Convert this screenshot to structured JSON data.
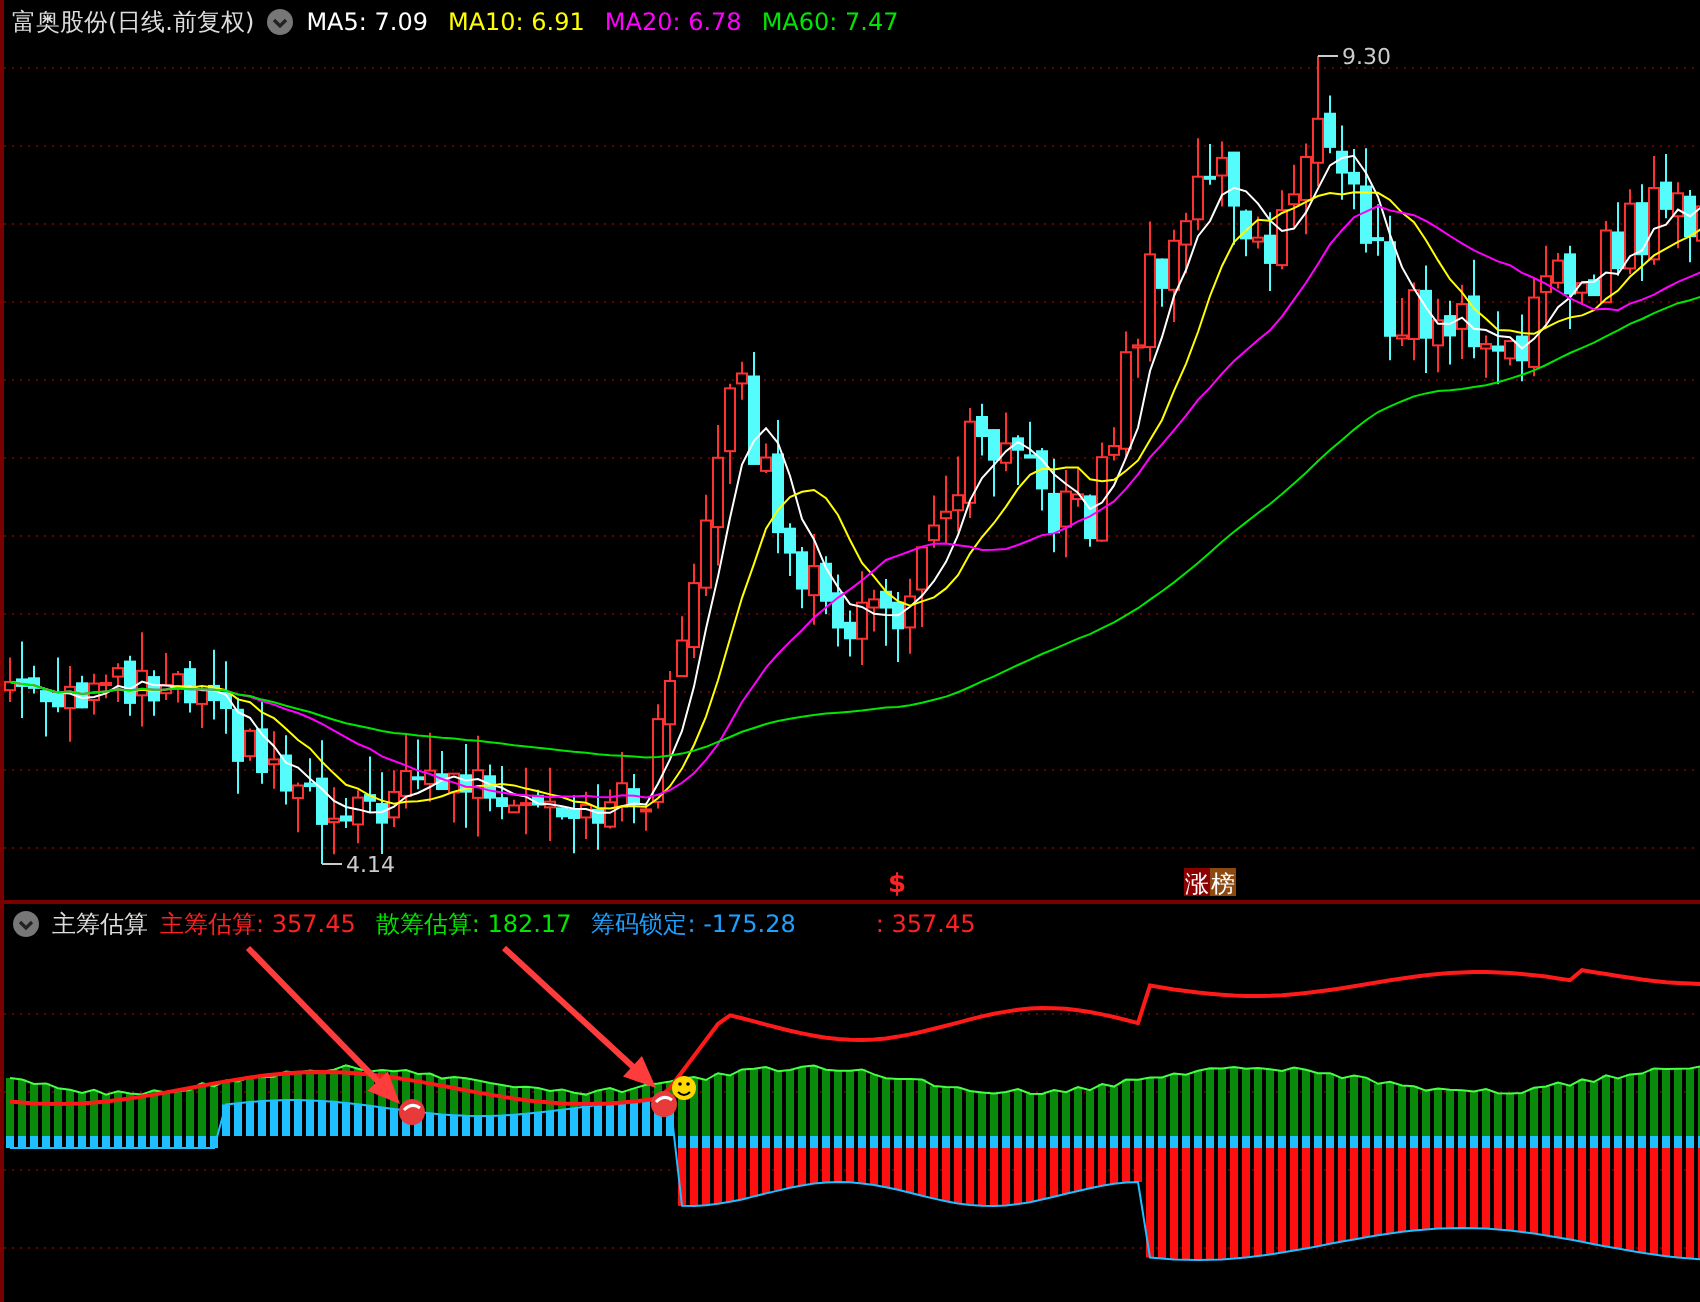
{
  "main_panel": {
    "title": "富奥股份(日线.前复权)",
    "indicators": [
      {
        "label": "MA5: 7.09",
        "color": "#ffffff"
      },
      {
        "label": "MA10: 6.91",
        "color": "#ffff00"
      },
      {
        "label": "MA20: 6.78",
        "color": "#ff00ff"
      },
      {
        "label": "MA60: 7.47",
        "color": "#00e600"
      }
    ],
    "high_label": "9.30",
    "low_label": "4.14",
    "markers": [
      {
        "kind": "signal",
        "text": "$"
      },
      {
        "kind": "badge",
        "text": "涨",
        "color": "#8b0000"
      },
      {
        "kind": "badge",
        "text": "榜",
        "color": "#8b4a10"
      }
    ]
  },
  "chip_panel": {
    "title": "主筹估算",
    "indicators": [
      {
        "label": "主筹估算: 357.45",
        "color": "#ff2020"
      },
      {
        "label": "散筹估算: 182.17",
        "color": "#00e600"
      },
      {
        "label": "筹码锁定: -175.28",
        "color": "#1ea0ff"
      },
      {
        "label": ": 357.45",
        "color": "#ff2020"
      }
    ]
  }
}
